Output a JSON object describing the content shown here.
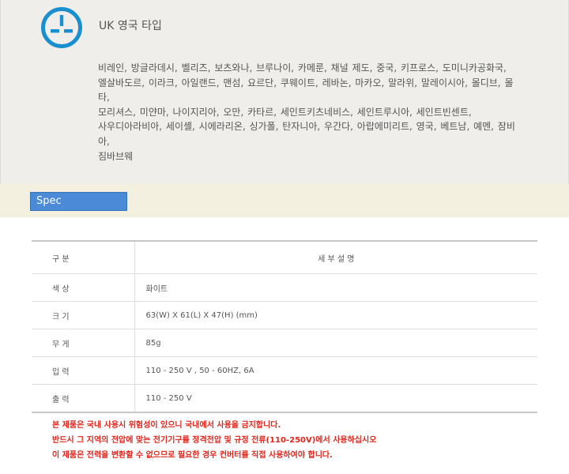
{
  "plug": {
    "icon": "uk-plug-icon",
    "title": "UK 영국 타입",
    "color": "#1a8fd0"
  },
  "countries": [
    "비레인, 방글라데시, 벨리즈, 보츠와나, 브루나이, 카메룬, 채널 제도, 중국, 키프로스, 도미니카공화국,",
    "엘살바도르, 이라크, 아일랜드, 맨섬, 요르단, 쿠웨이트, 레바논, 마카오, 말라위, 말레이시아, 몰디브, 몰타,",
    "모리셔스,   미얀마,   나이지리아,   오만,   카타르,   세인트키츠네비스,   세인트루시아,   세인트빈센트,",
    "사우디아라비아, 세이셸, 시에라리온, 싱가폴, 탄자니아, 우간다, 아랍에미리트, 영국, 베트남, 예멘, 잠비아,",
    "짐바브웨"
  ],
  "spec": {
    "tab_label": "Spec",
    "header": {
      "label": "구 분",
      "desc": "세 부 설 명"
    },
    "rows": [
      {
        "label": "색 상",
        "value": "화이트"
      },
      {
        "label": "크 기",
        "value": "63(W) X 61(L) X 47(H) (mm)"
      },
      {
        "label": "무 게",
        "value": "85g"
      },
      {
        "label": "입 력",
        "value": "110 - 250 V , 50 - 60HZ, 6A"
      },
      {
        "label": "출 력",
        "value": "110 - 250 V"
      }
    ]
  },
  "notice": [
    "본 제품은 국내 사용시 위험성이 있으니 국내에서 사용을 금지합니다.",
    "반드시 그 지역의 전압에 맞는 전기기구를 정격전압 및 규정 전류(110-250V)에서 사용하십시오",
    "이 제품은 전력을 변환할 수 없으므로 필요한 경우 컨버터를 직접 사용하여야 합니다."
  ],
  "colors": {
    "notice": "#e0261d",
    "tab": "#4a8ad6"
  }
}
